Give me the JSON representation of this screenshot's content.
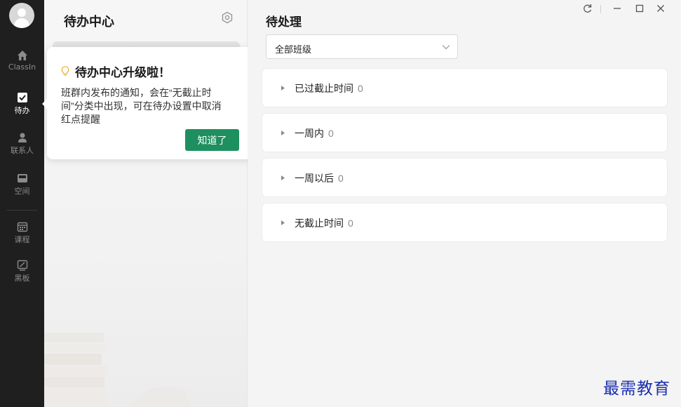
{
  "nav": {
    "items": [
      {
        "id": "classin",
        "label": "ClassIn",
        "icon": "home-icon",
        "active": false
      },
      {
        "id": "todo",
        "label": "待办",
        "icon": "checkbox-icon",
        "active": true
      },
      {
        "id": "contacts",
        "label": "联系人",
        "icon": "person-icon",
        "active": false
      },
      {
        "id": "space",
        "label": "空间",
        "icon": "inbox-icon",
        "active": false
      },
      {
        "id": "courses",
        "label": "课程",
        "icon": "calendar-icon",
        "active": false
      },
      {
        "id": "blackboard",
        "label": "黑板",
        "icon": "blackboard-icon",
        "active": false
      }
    ]
  },
  "todo_center": {
    "title": "待办中心",
    "settings_icon": "settings-icon"
  },
  "upgrade_tip": {
    "title": "待办中心升级啦！",
    "icon": "lightbulb-icon",
    "body": "班群内发布的通知，会在“无截止时间”分类中出现，可在待办设置中取消红点提醒",
    "button_label": "知道了"
  },
  "main": {
    "title": "待处理",
    "class_filter": {
      "selected": "全部班级"
    },
    "groups": [
      {
        "label": "已过截止时间",
        "count": "0"
      },
      {
        "label": "一周内",
        "count": "0"
      },
      {
        "label": "一周以后",
        "count": "0"
      },
      {
        "label": "无截止时间",
        "count": "0"
      }
    ]
  },
  "window_controls": {
    "refresh_icon": "refresh-icon",
    "minimize_icon": "minimize-icon",
    "maximize_icon": "maximize-icon",
    "close_icon": "close-icon"
  },
  "watermark": {
    "text": "最需教育"
  },
  "colors": {
    "rail_bg": "#1f1f1f",
    "accent_green": "#1e8f5e",
    "watermark": "#1a2fb0"
  }
}
